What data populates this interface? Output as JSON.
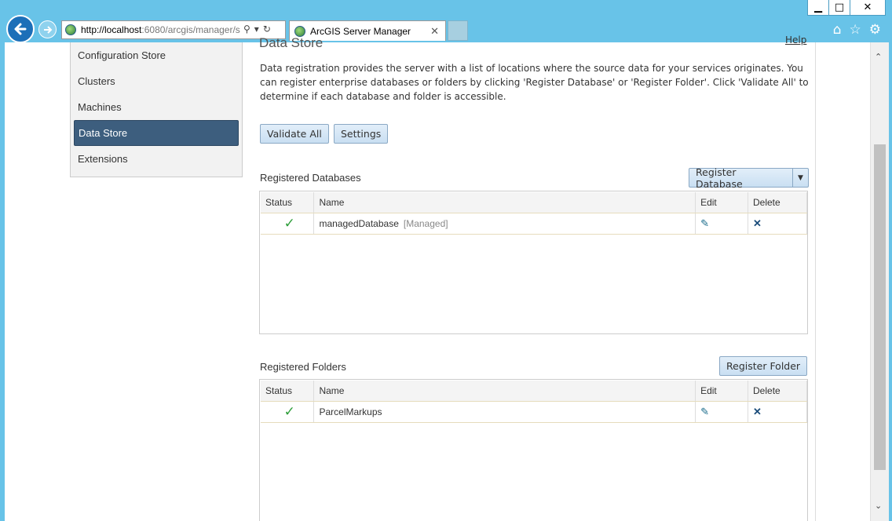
{
  "browser": {
    "url_host": "http://localhost",
    "url_rest": ":6080/arcgis/manager/s",
    "tab_title": "ArcGIS Server Manager"
  },
  "sidebar": {
    "items": [
      {
        "label": "Configuration Store"
      },
      {
        "label": "Clusters"
      },
      {
        "label": "Machines"
      },
      {
        "label": "Data Store"
      },
      {
        "label": "Extensions"
      }
    ]
  },
  "main": {
    "title": "Data Store",
    "help": "Help",
    "description": "Data registration provides the server with a list of locations where the source data for your services originates. You can register enterprise databases or folders by clicking 'Register Database' or 'Register Folder'. Click 'Validate All' to determine if each database and folder is accessible.",
    "validate_all": "Validate All",
    "settings": "Settings"
  },
  "databases": {
    "label": "Registered Databases",
    "register_button": "Register Database",
    "columns": [
      "Status",
      "Name",
      "Edit",
      "Delete"
    ],
    "rows": [
      {
        "status": "✓",
        "name": "managedDatabase",
        "tag": "[Managed]"
      }
    ]
  },
  "folders": {
    "label": "Registered Folders",
    "register_button": "Register Folder",
    "columns": [
      "Status",
      "Name",
      "Edit",
      "Delete"
    ],
    "rows": [
      {
        "status": "✓",
        "name": "ParcelMarkups"
      }
    ]
  },
  "colors": {
    "chrome": "#68c3e8",
    "active_nav": "#3d5e7e",
    "status_ok": "#2e9e3a"
  }
}
